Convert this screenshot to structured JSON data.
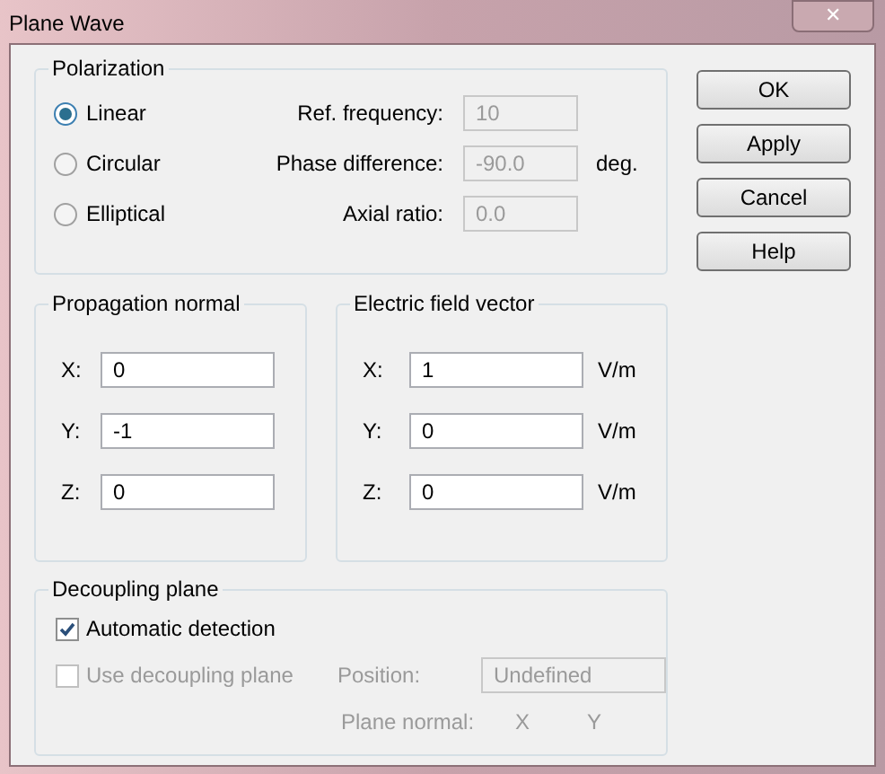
{
  "window": {
    "title": "Plane Wave",
    "close": "✕"
  },
  "polarization": {
    "title": "Polarization",
    "options": [
      {
        "label": "Linear",
        "selected": true
      },
      {
        "label": "Circular",
        "selected": false
      },
      {
        "label": "Elliptical",
        "selected": false
      }
    ],
    "fields": [
      {
        "label": "Ref. frequency:",
        "value": "10",
        "disabled": true
      },
      {
        "label": "Phase difference:",
        "value": "-90.0",
        "unit": "deg.",
        "disabled": true
      },
      {
        "label": "Axial ratio:",
        "value": "0.0",
        "disabled": true
      }
    ]
  },
  "propagation_normal": {
    "title": "Propagation normal",
    "fields": [
      {
        "label": "X:",
        "value": "0"
      },
      {
        "label": "Y:",
        "value": "-1"
      },
      {
        "label": "Z:",
        "value": "0"
      }
    ]
  },
  "electric_field_vector": {
    "title": "Electric field vector",
    "fields": [
      {
        "label": "X:",
        "value": "1",
        "unit": "V/m"
      },
      {
        "label": "Y:",
        "value": "0",
        "unit": "V/m"
      },
      {
        "label": "Z:",
        "value": "0",
        "unit": "V/m"
      }
    ]
  },
  "decoupling_plane": {
    "title": "Decoupling plane",
    "checks": [
      {
        "label": "Automatic detection",
        "checked": true,
        "disabled": false
      },
      {
        "label": "Use decoupling plane",
        "checked": false,
        "disabled": true
      }
    ],
    "position": {
      "label": "Position:",
      "value": "Undefined",
      "disabled": true
    },
    "plane_normal": {
      "label": "Plane normal:",
      "axes": [
        "X",
        "Y"
      ],
      "disabled": true
    }
  },
  "buttons": [
    "OK",
    "Apply",
    "Cancel",
    "Help"
  ]
}
